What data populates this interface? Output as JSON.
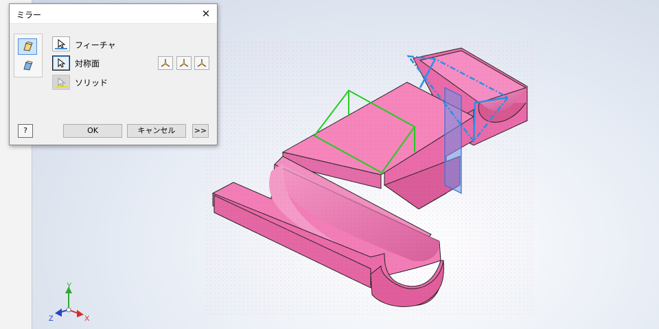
{
  "dialog": {
    "title": "ミラー",
    "close_glyph": "✕",
    "rows": {
      "features": {
        "label": "フィーチャ",
        "underline_color": "#3c8fd8"
      },
      "mirror_plane": {
        "label": "対称面"
      },
      "solids": {
        "label": "ソリッド",
        "underline_color": "#f2e600"
      }
    },
    "buttons": {
      "help": "?",
      "ok": "OK",
      "cancel": "キャンセル",
      "more": ">>"
    },
    "mode_icons": [
      "mirror-features-icon",
      "mirror-solids-icon"
    ],
    "plane_icons": [
      "yz-plane-icon",
      "xz-plane-icon",
      "xy-plane-icon"
    ]
  },
  "triad": {
    "x_label": "X",
    "y_label": "Y",
    "z_label": "Z",
    "colors": {
      "x": "#d62b2b",
      "y": "#2eaa2e",
      "z": "#2448c8"
    }
  },
  "model": {
    "face_color": "#f27cb6",
    "highlight_color": "#2a8fe6",
    "preview_color": "#22cc22"
  }
}
